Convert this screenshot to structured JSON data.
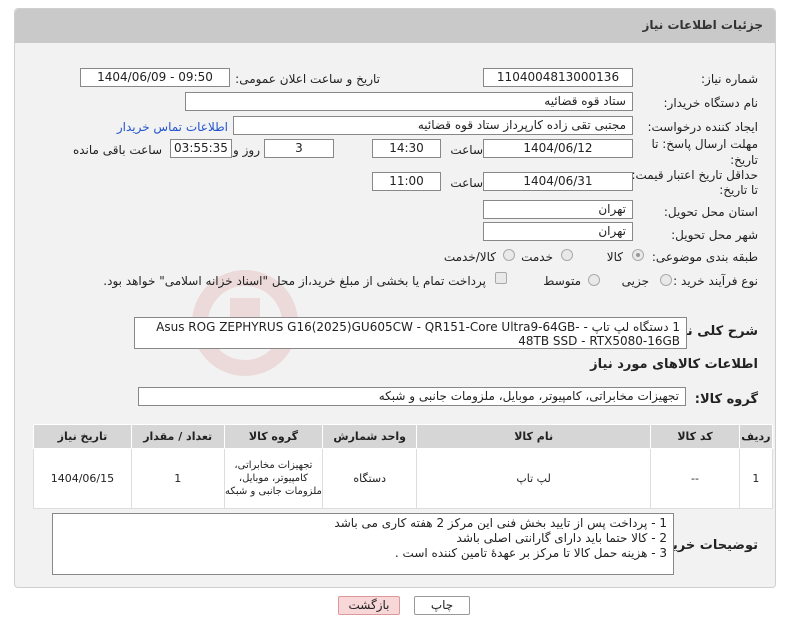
{
  "header": {
    "title": "جزئیات اطلاعات نیاز"
  },
  "fields": {
    "need_number_label": "شماره نیاز:",
    "need_number": "1104004813000136",
    "announce_label": "تاریخ و ساعت اعلان عمومی:",
    "announce_value": "1404/06/09 - 09:50",
    "buyer_org_label": "نام دستگاه خریدار:",
    "buyer_org": "ستاد قوه قضائیه",
    "requester_label": "ایجاد کننده درخواست:",
    "requester": "مجتبی تقی زاده کارپرداز ستاد قوه قضائیه",
    "contact_link": "اطلاعات تماس خریدار",
    "deadline_label_1": "مهلت ارسال پاسخ: تا",
    "deadline_label_2": "تاریخ:",
    "deadline_date": "1404/06/12",
    "time_label": "ساعت",
    "deadline_time": "14:30",
    "days_value": "3",
    "days_label": "روز و",
    "remaining_value": "03:55:35",
    "remaining_label": "ساعت باقی مانده",
    "min_validity_label_1": "حداقل تاریخ اعتبار قیمت:",
    "min_validity_label_2": "تا تاریخ:",
    "validity_date": "1404/06/31",
    "validity_time": "11:00",
    "province_label": "استان محل تحویل:",
    "province": "تهران",
    "city_label": "شهر محل تحویل:",
    "city": "تهران",
    "category_label": "طبقه بندی موضوعی:",
    "category_options": [
      "کالا",
      "خدمت",
      "کالا/خدمت"
    ],
    "process_label": "نوع فرآیند خرید :",
    "process_options": [
      "جزیی",
      "متوسط"
    ],
    "payment_note": "پرداخت تمام یا بخشی از مبلغ خرید،از محل \"اسناد خزانه اسلامی\" خواهد بود."
  },
  "description": {
    "label": "شرح کلی نیاز:",
    "text": "1 دستگاه لپ تاپ - Asus ROG ZEPHYRUS G16(2025)GU605CW - QR151-Core Ultra9-64GB- 48TB SSD - RTX5080-16GB"
  },
  "goods_section": {
    "title": "اطلاعات کالاهای مورد نیاز",
    "group_label": "گروه کالا:",
    "group_value": "تجهیزات مخابراتی، کامپیوتر، موبایل، ملزومات جانبی و شبکه"
  },
  "table": {
    "headers": [
      "ردیف",
      "کد کالا",
      "نام کالا",
      "واحد شمارش",
      "گروه کالا",
      "تعداد / مقدار",
      "تاریخ نیاز"
    ],
    "rows": [
      [
        "1",
        "--",
        "لپ تاپ",
        "دستگاه",
        "تجهیزات مخابراتی، کامپیوتر، موبایل، ملزومات جانبی و شبکه",
        "1",
        "1404/06/15"
      ]
    ]
  },
  "buyer_notes": {
    "label": "توضیحات خریدار:",
    "lines": [
      "1 - پرداخت پس از تایید بخش فنی این مرکز 2 هفته کاری می باشد",
      "2 - کالا حتما باید دارای گارانتی اصلی باشد",
      "3 - هزینه حمل کالا تا مرکز بر عهدهٔ تامین کننده است ."
    ]
  },
  "buttons": {
    "print": "چاپ",
    "back": "بازگشت"
  },
  "colors": {
    "back_button_bg": "#f7d7d7",
    "back_button_border": "#d99",
    "link": "#2255cc"
  }
}
